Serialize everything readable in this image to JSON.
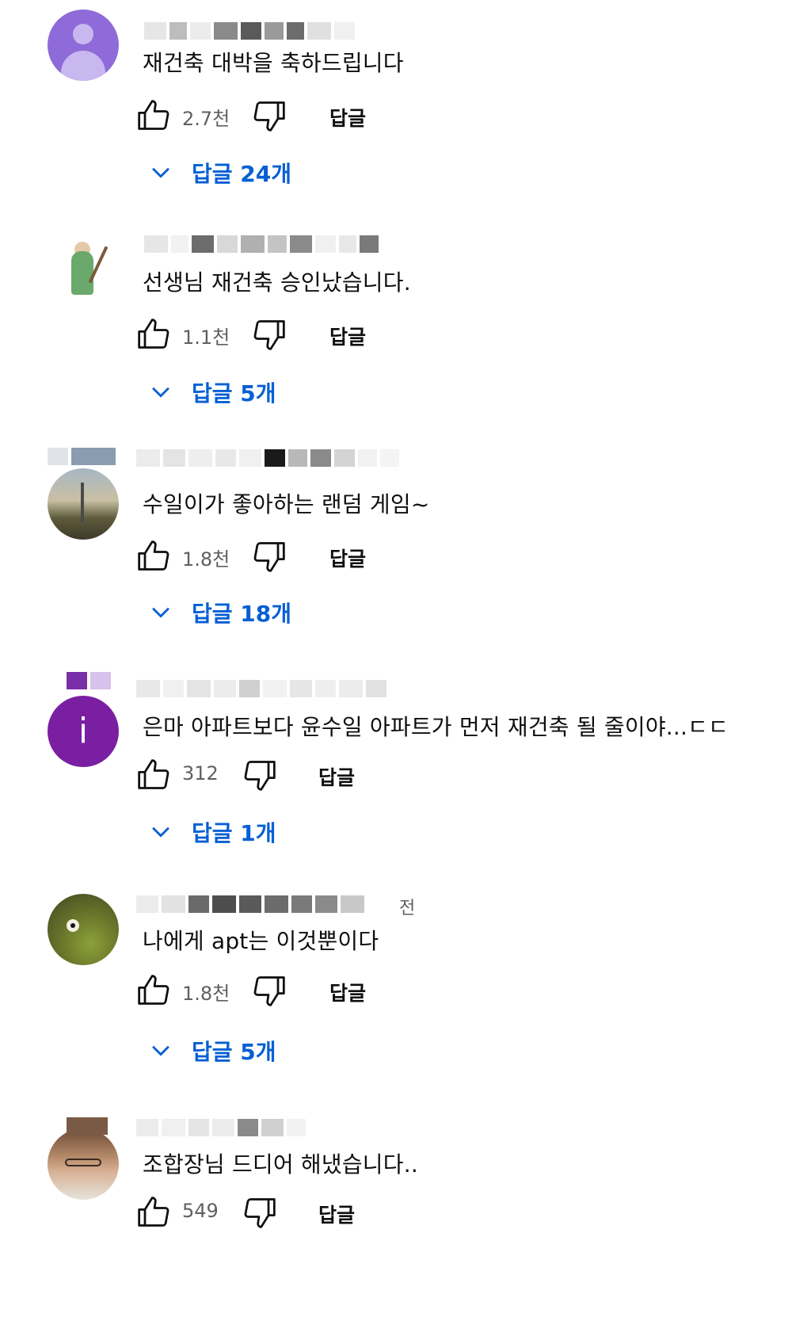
{
  "comments": [
    {
      "avatar": "default-person-avatar",
      "text": "재건축 대박을 축하드립니다",
      "likes": "2.7천",
      "reply_label": "답글",
      "replies_label": "답글 24개"
    },
    {
      "avatar": "character-figure-avatar",
      "text": "선생님 재건축 승인났습니다.",
      "likes": "1.1천",
      "reply_label": "답글",
      "replies_label": "답글 5개"
    },
    {
      "avatar": "landscape-photo-avatar",
      "text": "수일이가 좋아하는 랜덤 게임~",
      "likes": "1.8천",
      "reply_label": "답글",
      "replies_label": "답글 18개"
    },
    {
      "avatar": "letter-avatar",
      "avatar_letter": "i",
      "text": "은마 아파트보다 윤수일 아파트가 먼저 재건축 될 줄이야...ㄷㄷ",
      "likes": "312",
      "reply_label": "답글",
      "replies_label": "답글 1개"
    },
    {
      "avatar": "bird-photo-avatar",
      "text": "나에게 apt는 이것뿐이다",
      "likes": "1.8천",
      "reply_label": "답글",
      "replies_label": "답글 5개",
      "header_suffix": "전"
    },
    {
      "avatar": "face-photo-avatar",
      "text": "조합장님 드디어 해냈습니다..",
      "likes": "549",
      "reply_label": "답글"
    }
  ],
  "colors": {
    "reply_link": "#065fd4",
    "meta_gray": "#606060",
    "text": "#0f0f0f"
  }
}
